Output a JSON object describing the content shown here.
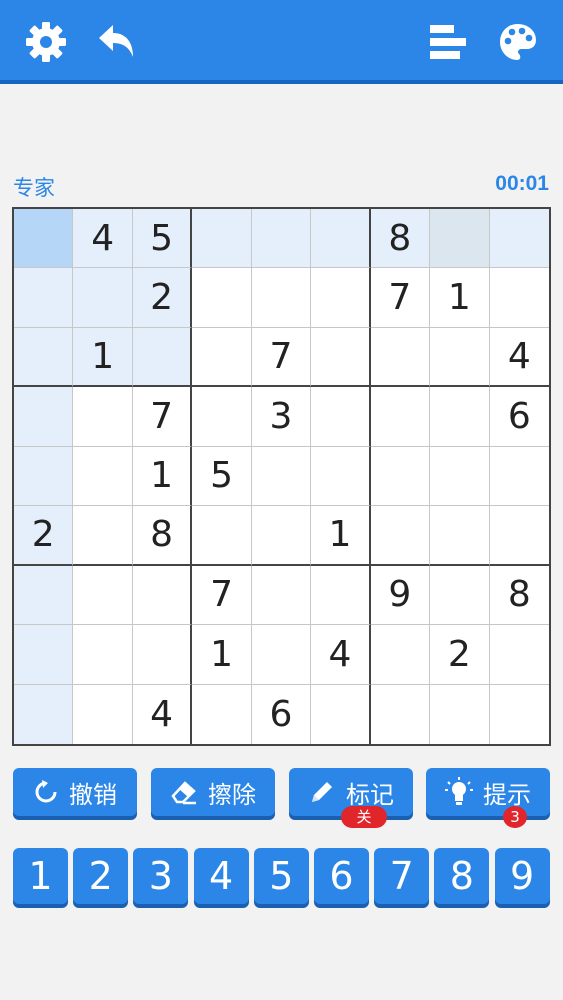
{
  "header": {
    "icons": [
      "gear-icon",
      "undo-arrow-icon",
      "stats-bars-icon",
      "palette-icon"
    ],
    "bg_color": "#2b86e8"
  },
  "status": {
    "difficulty": "专家",
    "timer": "00:01"
  },
  "board": {
    "rows": [
      [
        "",
        "4",
        "5",
        "",
        "",
        "",
        "8",
        "",
        ""
      ],
      [
        "",
        "",
        "2",
        "",
        "",
        "",
        "7",
        "1",
        ""
      ],
      [
        "",
        "1",
        "",
        "",
        "7",
        "",
        "",
        "",
        "4"
      ],
      [
        "",
        "",
        "7",
        "",
        "3",
        "",
        "",
        "",
        "6"
      ],
      [
        "",
        "",
        "1",
        "5",
        "",
        "",
        "",
        "",
        ""
      ],
      [
        "2",
        "",
        "8",
        "",
        "",
        "1",
        "",
        "",
        ""
      ],
      [
        "",
        "",
        "",
        "7",
        "",
        "",
        "9",
        "",
        "8"
      ],
      [
        "",
        "",
        "",
        "1",
        "",
        "4",
        "",
        "2",
        ""
      ],
      [
        "",
        "",
        "4",
        "",
        "6",
        "",
        "",
        "",
        ""
      ]
    ],
    "selected": {
      "row": 0,
      "col": 0
    },
    "highlight_color": "#e4effb",
    "selected_color": "#b5d6f7"
  },
  "actions": {
    "undo": {
      "label": "撤销",
      "icon": "refresh-icon"
    },
    "erase": {
      "label": "擦除",
      "icon": "eraser-icon"
    },
    "notes": {
      "label": "标记",
      "icon": "pencil-icon",
      "badge": "关"
    },
    "hint": {
      "label": "提示",
      "icon": "lightbulb-icon",
      "badge": "3"
    }
  },
  "numpad": [
    "1",
    "2",
    "3",
    "4",
    "5",
    "6",
    "7",
    "8",
    "9"
  ]
}
